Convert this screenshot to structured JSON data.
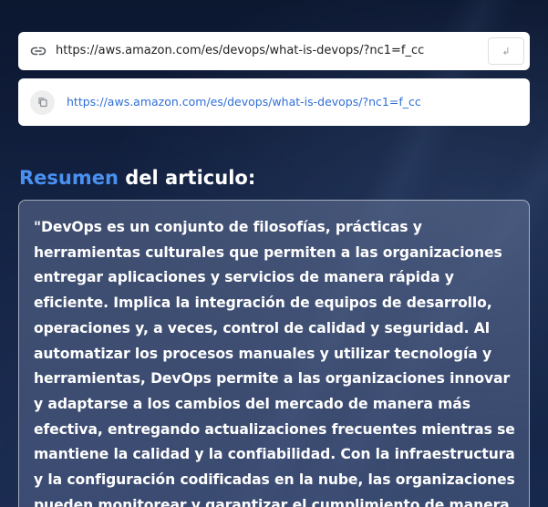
{
  "url_input": {
    "value": "https://aws.amazon.com/es/devops/what-is-devops/?nc1=f_cc",
    "submit_glyph": "↲"
  },
  "result": {
    "link_text": "https://aws.amazon.com/es/devops/what-is-devops/?nc1=f_cc"
  },
  "summary": {
    "heading_accent": "Resumen",
    "heading_rest": " del articulo:",
    "text": "\"DevOps es un conjunto de filosofías, prácticas y herramientas culturales que permiten a las organizaciones entregar aplicaciones y servicios de manera rápida y eficiente. Implica la integración de equipos de desarrollo, operaciones y, a veces, control de calidad y seguridad. Al automatizar los procesos manuales y utilizar tecnología y herramientas, DevOps permite a las organizaciones innovar y adaptarse a los cambios del mercado de manera más efectiva, entregando actualizaciones frecuentes mientras se mantiene la calidad y la confiabilidad. Con la infraestructura y la configuración codificadas en la nube, las organizaciones pueden monitorear y garantizar el cumplimiento de manera"
  },
  "icons": {
    "url_field": "link-icon",
    "submit": "return-arrow-icon",
    "copy": "copy-icon"
  },
  "colors": {
    "accent": "#4a90f0",
    "link": "#2f6fd6",
    "card_background": "#ffffff"
  }
}
